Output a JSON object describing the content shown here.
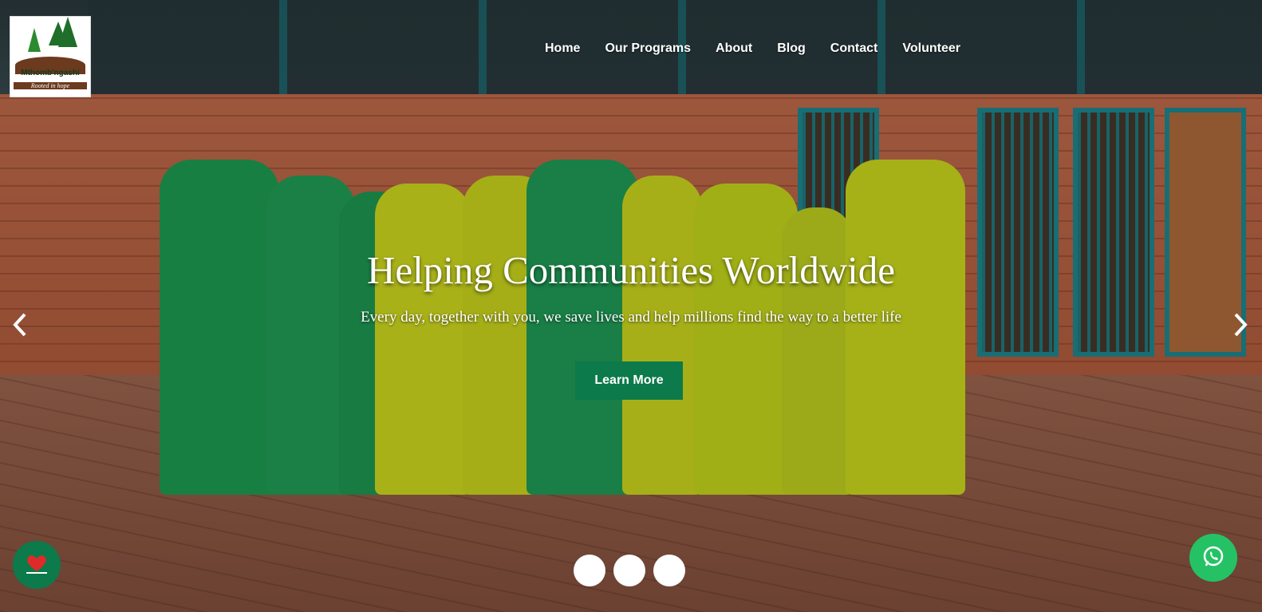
{
  "logo": {
    "name": "Mthomb'ngashi",
    "tagline": "Rooted in hope"
  },
  "nav": {
    "items": [
      "Home",
      "Our Programs",
      "About",
      "Blog",
      "Contact",
      "Volunteer"
    ]
  },
  "hero": {
    "title": "Helping Communities Worldwide",
    "subtitle": "Every day, together with you, we save lives and help millions find the way to a better life",
    "cta_label": "Learn More",
    "prev_icon": "chevron-left-icon",
    "next_icon": "chevron-right-icon",
    "slides_count": 3
  },
  "floating": {
    "favorite_icon": "heart-icon",
    "whatsapp_icon": "whatsapp-icon"
  },
  "colors": {
    "brand_green": "#0c7a4a",
    "whatsapp_green": "#25c265"
  }
}
